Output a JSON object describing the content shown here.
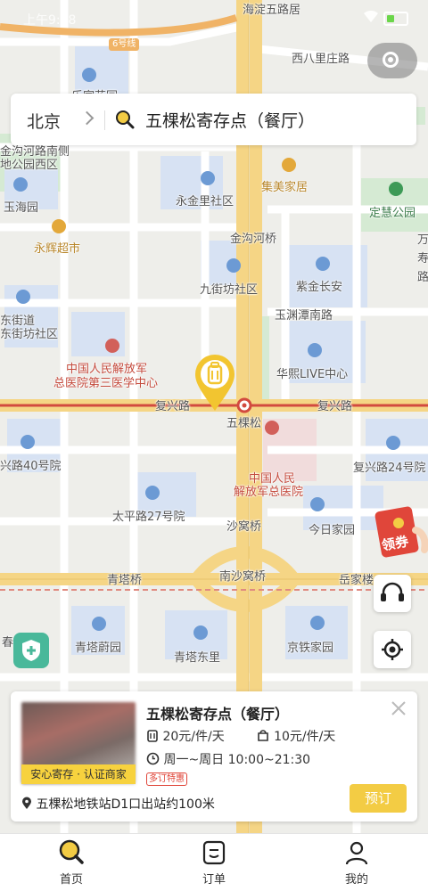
{
  "status_bar": {
    "time": "上午9:28"
  },
  "search": {
    "city": "北京",
    "query": "五棵松寄存点（餐厅）"
  },
  "map": {
    "subway_badge": "6号线",
    "labels": {
      "haidian_wulu": "海淀五路居",
      "xibali": "西八里庄路",
      "lejia": "乐家花园",
      "jinhua_south": "金沟河路南侧",
      "dijiapark": "地公园西区",
      "yuhaiyuan": "玉海园",
      "yonghui": "永辉超市",
      "yongjinli": "永金里社区",
      "jimei": "集美家居",
      "dinghui_park": "定慧公园",
      "jingouhe_bridge": "金沟河桥",
      "wanshou1": "万",
      "wanshou2": "寿",
      "wanshou3": "路",
      "ziji": "紫金长安",
      "jiujiefang": "九街坊社区",
      "yuyuantan": "玉渊潭南路",
      "street_office1": "东街道",
      "street_office2": "东街坊社区",
      "huaxi": "华熙LIVE中心",
      "hospital3_1": "中国人民解放军",
      "hospital3_2": "总医院第三医学中心",
      "fuxing_w": "复兴路",
      "fuxing_e": "复兴路",
      "wukesong": "五棵松",
      "fuxing40": "兴路40号院",
      "fuxing24": "复兴路24号院",
      "pla1": "中国人民",
      "pla2": "解放军总医院",
      "taiping27": "太平路27号院",
      "shawoqiao": "沙窝桥",
      "jinri": "今日家园",
      "qingta_bridge": "青塔桥",
      "nanshawo": "南沙窝桥",
      "yuejia": "岳家楼",
      "qingtawei": "青塔蔚园",
      "qingtadong": "青塔东里",
      "jingtie": "京铁家园",
      "chun": "春"
    }
  },
  "coupon": {
    "label": "领券"
  },
  "poi_card": {
    "title": "五棵松寄存点（餐厅）",
    "tag": "安心寄存 · 认证商家",
    "price_luggage": "20元/件/天",
    "price_bag": "10元/件/天",
    "hours": "周一~周日 10:00~21:30",
    "badge": "多订特惠",
    "address": "五棵松地铁站D1口出站约100米",
    "book_label": "预订"
  },
  "tabs": [
    {
      "label": "首页"
    },
    {
      "label": "订单"
    },
    {
      "label": "我的"
    }
  ],
  "colors": {
    "accent": "#f3cc44",
    "road_main": "#f5d585",
    "rail": "#d24a3f"
  }
}
